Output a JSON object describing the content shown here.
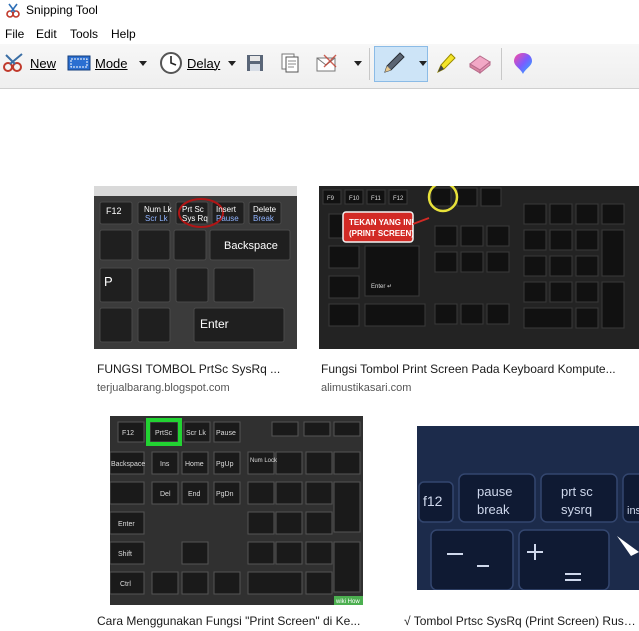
{
  "window": {
    "title": "Snipping Tool"
  },
  "menu": {
    "items": [
      "File",
      "Edit",
      "Tools",
      "Help"
    ]
  },
  "toolbar": {
    "new_label": "New",
    "mode_label": "Mode",
    "delay_label": "Delay"
  },
  "results": [
    {
      "title": "FUNGSI TOMBOL PrtSc SysRq ...",
      "source": "terjualbarang.blogspot.com",
      "keys": {
        "f12": "F12",
        "numlk": "Num Lk",
        "numlk2": "Scr Lk",
        "prtsc": "Prt Sc",
        "sysrq": "Sys Rq",
        "insert": "Insert",
        "pause": "Pause",
        "delete": "Delete",
        "break": "Break",
        "backspace": "Backspace",
        "p": "P",
        "enter": "Enter"
      }
    },
    {
      "title": "Fungsi Tombol Print Screen Pada Keyboard Kompute...",
      "source": "alimustikasari.com",
      "callout_line1": "TEKAN YANG INI",
      "callout_line2": "(PRINT SCREEN)",
      "keys": {
        "f9": "F9",
        "f10": "F10",
        "f11": "F11",
        "f12": "F12",
        "enter": "Enter ↵"
      }
    },
    {
      "title": "Cara Menggunakan Fungsi \"Print Screen\" di Ke...",
      "source": "",
      "keys": {
        "f12": "F12",
        "prtsc": "PrtSc",
        "scrlk": "Scr Lk",
        "pause": "Pause",
        "backspace": "Backspace",
        "ins": "Ins",
        "home": "Home",
        "pgup": "PgUp",
        "numlock": "Num Lock",
        "del": "Del",
        "end": "End",
        "pgdn": "PgDn",
        "enter": "Enter",
        "shift": "Shift",
        "ctrl": "Ctrl",
        "wikihow": "wiki How"
      }
    },
    {
      "title": "√ Tombol Prtsc SysRq (Print Screen) Rusak, ...",
      "source": "",
      "keys": {
        "f12": "f12",
        "pause": "pause",
        "break": "break",
        "prtsc": "prt sc",
        "sysrq": "sysrq",
        "ins": "ins"
      }
    }
  ]
}
